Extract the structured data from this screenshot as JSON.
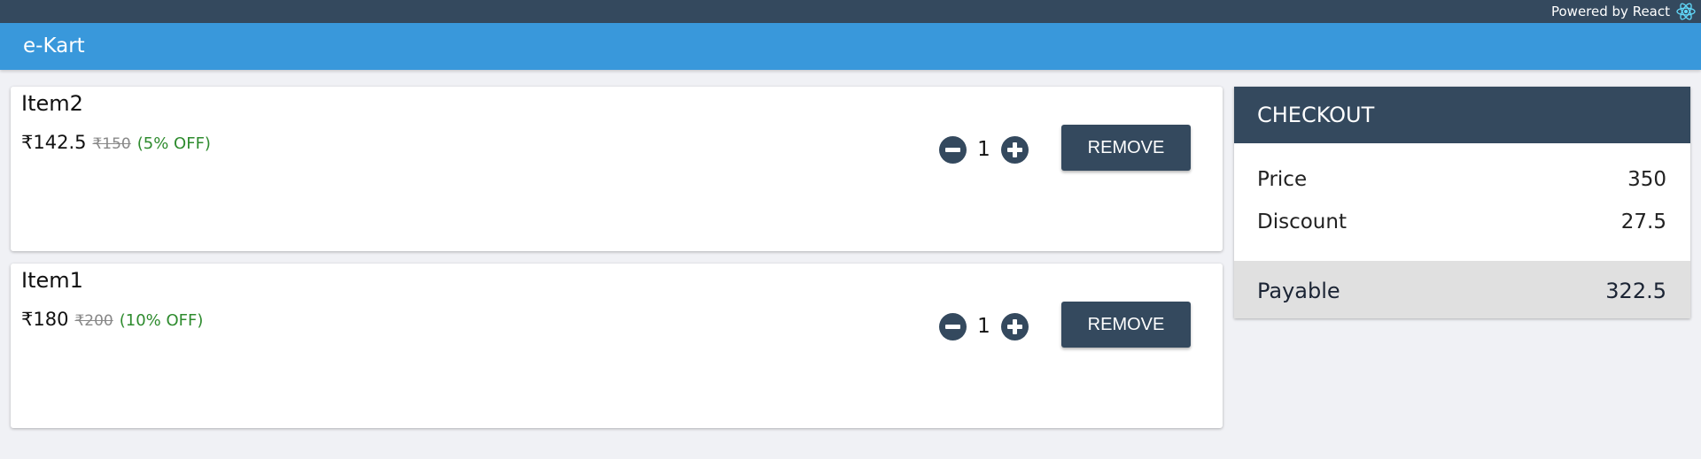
{
  "topbar": {
    "powered_by": "Powered by React",
    "icon": "react-icon"
  },
  "header": {
    "brand": "e-Kart",
    "color": "#3998db"
  },
  "cart": {
    "items": [
      {
        "name": "Item2",
        "price": "₹142.5",
        "mrp": "₹150",
        "discount": "(5% OFF)",
        "quantity": "1",
        "remove_label": "REMOVE"
      },
      {
        "name": "Item1",
        "price": "₹180",
        "mrp": "₹200",
        "discount": "(10% OFF)",
        "quantity": "1",
        "remove_label": "REMOVE"
      }
    ]
  },
  "checkout": {
    "title": "CHECKOUT",
    "price_label": "Price",
    "price_value": "350",
    "discount_label": "Discount",
    "discount_value": "27.5",
    "payable_label": "Payable",
    "payable_value": "322.5"
  },
  "colors": {
    "dark": "#34495e",
    "accent": "#3998db",
    "discount_green": "#2e8b2e"
  }
}
